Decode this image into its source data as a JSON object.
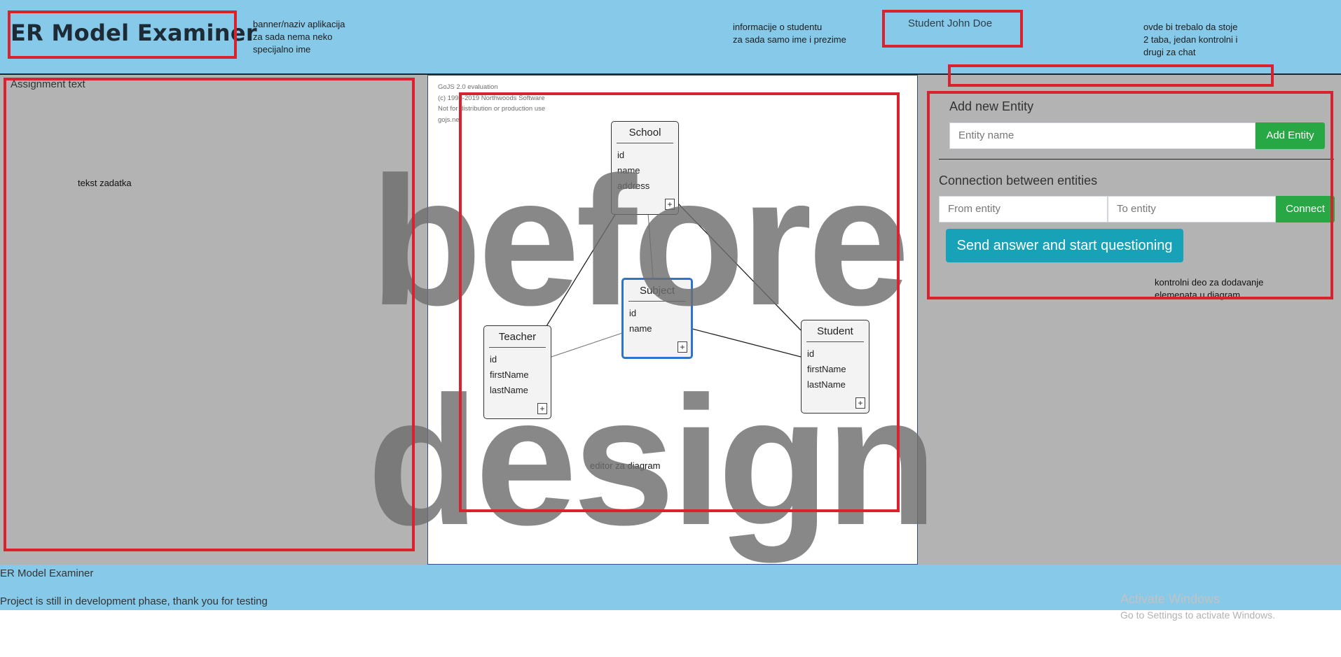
{
  "header": {
    "app_title": "ER Model Examiner",
    "banner_note": "banner/naziv aplikacija\nza sada nema neko\nspecijalno ime",
    "student_note": "informacije o studentu\nza sada samo ime i prezime",
    "student_name": "Student John Doe",
    "tabs_note": "ovde bi trebalo da stoje\n2 taba, jedan kontrolni i\ndrugi za chat"
  },
  "assignment": {
    "label": "Assignment text",
    "task_note": "tekst zadatka"
  },
  "diagram": {
    "gojs_notice": "GoJS 2.0 evaluation\n(c) 1998-2019 Northwoods Software\nNot for distribution or production use\ngojs.net",
    "editor_note": "editor za diagram",
    "entities": [
      {
        "name": "School",
        "attributes": [
          "id",
          "name",
          "address"
        ],
        "expand": "+"
      },
      {
        "name": "Subject",
        "attributes": [
          "id",
          "name"
        ],
        "expand": "+"
      },
      {
        "name": "Teacher",
        "attributes": [
          "id",
          "firstName",
          "lastName"
        ],
        "expand": "+"
      },
      {
        "name": "Student",
        "attributes": [
          "id",
          "firstName",
          "lastName"
        ],
        "expand": "+"
      }
    ],
    "links": [
      [
        "School",
        "Teacher"
      ],
      [
        "School",
        "Subject"
      ],
      [
        "School",
        "Student"
      ],
      [
        "Teacher",
        "Subject"
      ],
      [
        "Subject",
        "Student"
      ]
    ],
    "selected_entity": "Subject"
  },
  "controls": {
    "add_entity_title": "Add new Entity",
    "entity_name_placeholder": "Entity name",
    "add_entity_button": "Add Entity",
    "connection_title": "Connection between entities",
    "from_placeholder": "From entity",
    "to_placeholder": "To entity",
    "connect_button": "Connect",
    "send_button": "Send answer and start questioning",
    "control_note": "kontrolni deo za dodavanje\nelemenata u diagram"
  },
  "footer": {
    "title": "ER Model Examiner",
    "note": "Project is still in development phase, thank you for testing"
  },
  "windows": {
    "activate": "Activate Windows",
    "goto_settings": "Go to Settings to activate Windows."
  },
  "watermark": {
    "line1": "before",
    "line2": "design"
  },
  "colors": {
    "header_bg": "#87c9e9",
    "panel_bg": "#b3b3b3",
    "annotation_red": "#d8222e",
    "button_green": "#28a745",
    "button_teal": "#17a2b8",
    "selection_blue": "#2f74c8"
  }
}
